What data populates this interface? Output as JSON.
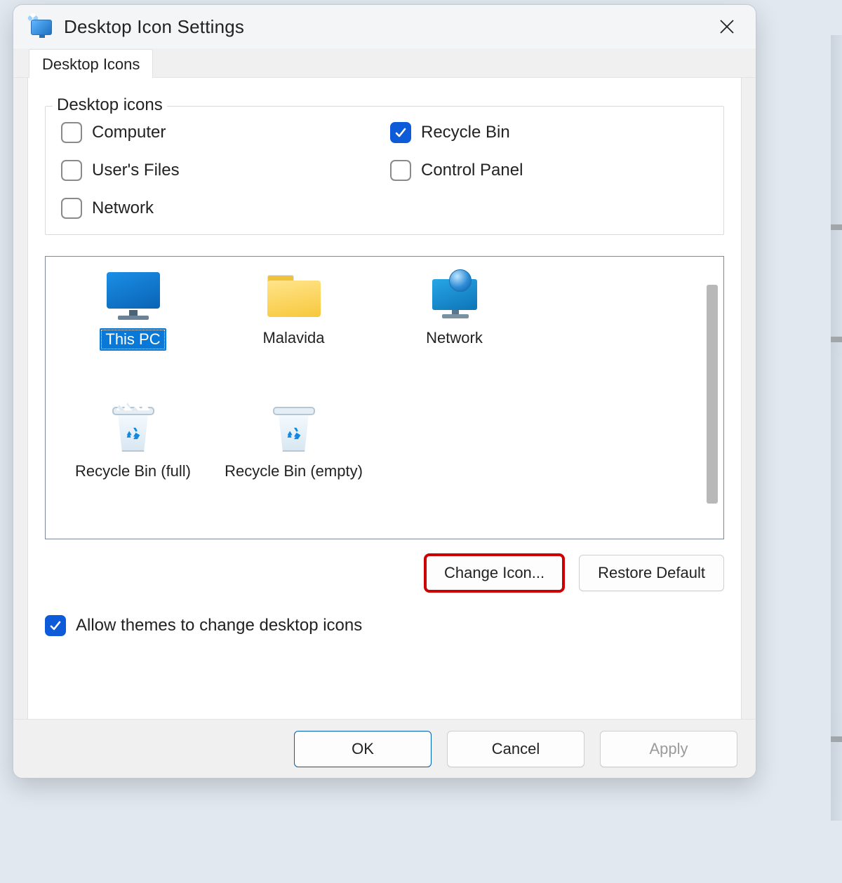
{
  "window": {
    "title": "Desktop Icon Settings"
  },
  "tabs": [
    {
      "label": "Desktop Icons"
    }
  ],
  "fieldset": {
    "legend": "Desktop icons",
    "options": [
      {
        "label": "Computer",
        "checked": false
      },
      {
        "label": "Recycle Bin",
        "checked": true
      },
      {
        "label": "User's Files",
        "checked": false
      },
      {
        "label": "Control Panel",
        "checked": false
      },
      {
        "label": "Network",
        "checked": false
      }
    ]
  },
  "iconlist": {
    "items": [
      {
        "label": "This PC",
        "glyph": "thispc",
        "selected": true
      },
      {
        "label": "Malavida",
        "glyph": "folder",
        "selected": false
      },
      {
        "label": "Network",
        "glyph": "network",
        "selected": false
      },
      {
        "label": "Recycle Bin (full)",
        "glyph": "bin-full",
        "selected": false
      },
      {
        "label": "Recycle Bin (empty)",
        "glyph": "bin",
        "selected": false
      }
    ]
  },
  "buttons": {
    "change_icon": "Change Icon...",
    "restore_default": "Restore Default",
    "ok": "OK",
    "cancel": "Cancel",
    "apply": "Apply"
  },
  "themes_checkbox": {
    "label": "Allow themes to change desktop icons",
    "checked": true
  },
  "highlight": "change_icon"
}
